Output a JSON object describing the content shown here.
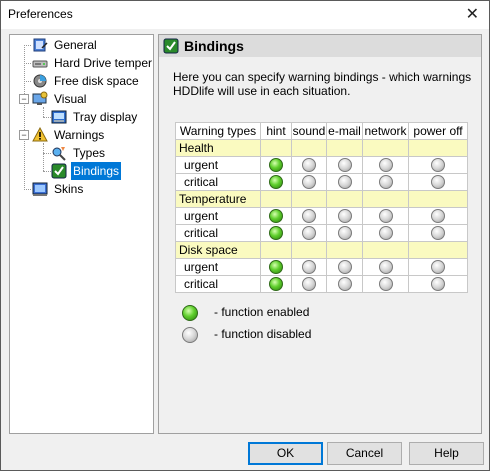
{
  "window": {
    "title": "Preferences",
    "close_label": "✕"
  },
  "tree": {
    "items": [
      {
        "label": "General",
        "icon": "general-icon"
      },
      {
        "label": "Hard Drive temper",
        "icon": "hard-drive-icon"
      },
      {
        "label": "Free disk space",
        "icon": "disk-space-icon"
      },
      {
        "label": "Visual",
        "icon": "visual-icon"
      },
      {
        "label": "Tray display",
        "icon": "tray-display-icon"
      },
      {
        "label": "Warnings",
        "icon": "warnings-icon"
      },
      {
        "label": "Types",
        "icon": "types-icon"
      },
      {
        "label": "Bindings",
        "icon": "bindings-icon",
        "selected": true
      },
      {
        "label": "Skins",
        "icon": "skins-icon"
      }
    ]
  },
  "panel": {
    "title": "Bindings",
    "description": "Here you can specify warning bindings - which warnings HDDlife will use in each situation."
  },
  "grid": {
    "headers": [
      "Warning types",
      "hint",
      "sound",
      "e-mail",
      "network",
      "power off"
    ],
    "categories": [
      {
        "name": "Health",
        "rows": [
          {
            "label": "urgent",
            "states": [
              true,
              false,
              false,
              false,
              false
            ]
          },
          {
            "label": "critical",
            "states": [
              true,
              false,
              false,
              false,
              false
            ]
          }
        ]
      },
      {
        "name": "Temperature",
        "rows": [
          {
            "label": "urgent",
            "states": [
              true,
              false,
              false,
              false,
              false
            ]
          },
          {
            "label": "critical",
            "states": [
              true,
              false,
              false,
              false,
              false
            ]
          }
        ]
      },
      {
        "name": "Disk space",
        "rows": [
          {
            "label": "urgent",
            "states": [
              true,
              false,
              false,
              false,
              false
            ]
          },
          {
            "label": "critical",
            "states": [
              true,
              false,
              false,
              false,
              false
            ]
          }
        ]
      }
    ]
  },
  "legend": {
    "enabled": "- function enabled",
    "disabled": "- function disabled"
  },
  "buttons": {
    "ok": "OK",
    "cancel": "Cancel",
    "help": "Help"
  },
  "colors": {
    "enabled": "#5fcf2c",
    "disabled": "#d6d6d6",
    "category_bg": "#fafac0",
    "selection": "#0078d7"
  }
}
